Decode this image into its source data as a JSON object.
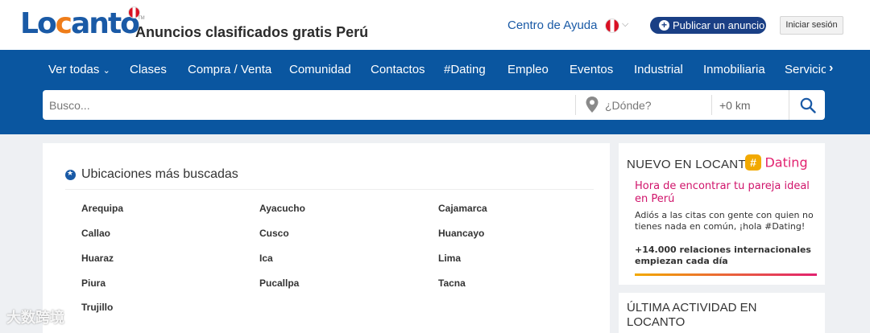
{
  "header": {
    "logo_lo": "Lo",
    "logo_c": "c",
    "logo_anto": "anto",
    "logo_tm": "TM",
    "site_title": "Anuncios clasificados gratis Perú",
    "help_link": "Centro de Ayuda",
    "publish_label": "Publicar un anuncio",
    "login_label": "Iniciar sesión"
  },
  "nav": {
    "items": [
      "Ver todas",
      "Clases",
      "Compra / Venta",
      "Comunidad",
      "Contactos",
      "#Dating",
      "Empleo",
      "Eventos",
      "Industrial",
      "Inmobiliaria",
      "Servicios"
    ],
    "ver_todas_chevron": "⌄"
  },
  "search": {
    "query_placeholder": "Busco...",
    "where_placeholder": "¿Dónde?",
    "radius": "+0 km"
  },
  "locations": {
    "title": "Ubicaciones más buscadas",
    "cities": [
      "Arequipa",
      "Ayacucho",
      "Cajamarca",
      "Callao",
      "Cusco",
      "Huancayo",
      "Huaraz",
      "Ica",
      "Lima",
      "Piura",
      "Pucallpa",
      "Tacna",
      "Trujillo"
    ]
  },
  "dating_promo": {
    "nuevo": "NUEVO EN LOCANTO",
    "logo_hash": "#",
    "logo_word": "Dating",
    "headline": "Hora de encontrar tu pareja ideal en Perú",
    "description": "Adiós a las citas con gente con quien no tienes nada en común, ¡hola #Dating!",
    "stats": "+14.000 relaciones internacionales empiezan cada día"
  },
  "activity": {
    "title": "ÚLTIMA ACTIVIDAD EN LOCANTO"
  },
  "watermark": "大数跨境",
  "colors": {
    "brand_blue": "#0a56a0",
    "logo_blue": "#1a5aa6",
    "logo_orange": "#ef7d1a",
    "publish_button": "#1a3f85",
    "dating_pink": "#e2216f",
    "dating_yellow": "#f2a900"
  }
}
